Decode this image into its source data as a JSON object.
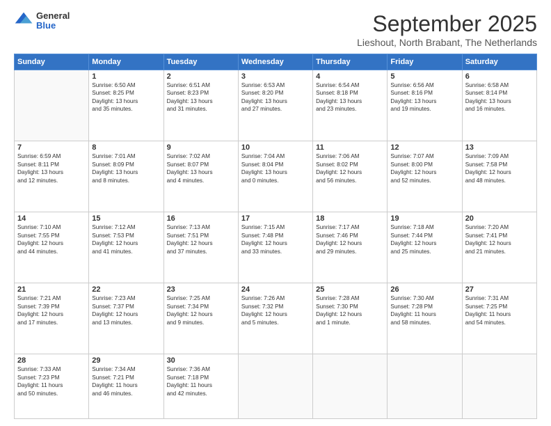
{
  "header": {
    "logo": {
      "general": "General",
      "blue": "Blue"
    },
    "title": "September 2025",
    "location": "Lieshout, North Brabant, The Netherlands"
  },
  "weekdays": [
    "Sunday",
    "Monday",
    "Tuesday",
    "Wednesday",
    "Thursday",
    "Friday",
    "Saturday"
  ],
  "weeks": [
    [
      {
        "day": "",
        "info": ""
      },
      {
        "day": "1",
        "info": "Sunrise: 6:50 AM\nSunset: 8:25 PM\nDaylight: 13 hours\nand 35 minutes."
      },
      {
        "day": "2",
        "info": "Sunrise: 6:51 AM\nSunset: 8:23 PM\nDaylight: 13 hours\nand 31 minutes."
      },
      {
        "day": "3",
        "info": "Sunrise: 6:53 AM\nSunset: 8:20 PM\nDaylight: 13 hours\nand 27 minutes."
      },
      {
        "day": "4",
        "info": "Sunrise: 6:54 AM\nSunset: 8:18 PM\nDaylight: 13 hours\nand 23 minutes."
      },
      {
        "day": "5",
        "info": "Sunrise: 6:56 AM\nSunset: 8:16 PM\nDaylight: 13 hours\nand 19 minutes."
      },
      {
        "day": "6",
        "info": "Sunrise: 6:58 AM\nSunset: 8:14 PM\nDaylight: 13 hours\nand 16 minutes."
      }
    ],
    [
      {
        "day": "7",
        "info": "Sunrise: 6:59 AM\nSunset: 8:11 PM\nDaylight: 13 hours\nand 12 minutes."
      },
      {
        "day": "8",
        "info": "Sunrise: 7:01 AM\nSunset: 8:09 PM\nDaylight: 13 hours\nand 8 minutes."
      },
      {
        "day": "9",
        "info": "Sunrise: 7:02 AM\nSunset: 8:07 PM\nDaylight: 13 hours\nand 4 minutes."
      },
      {
        "day": "10",
        "info": "Sunrise: 7:04 AM\nSunset: 8:04 PM\nDaylight: 13 hours\nand 0 minutes."
      },
      {
        "day": "11",
        "info": "Sunrise: 7:06 AM\nSunset: 8:02 PM\nDaylight: 12 hours\nand 56 minutes."
      },
      {
        "day": "12",
        "info": "Sunrise: 7:07 AM\nSunset: 8:00 PM\nDaylight: 12 hours\nand 52 minutes."
      },
      {
        "day": "13",
        "info": "Sunrise: 7:09 AM\nSunset: 7:58 PM\nDaylight: 12 hours\nand 48 minutes."
      }
    ],
    [
      {
        "day": "14",
        "info": "Sunrise: 7:10 AM\nSunset: 7:55 PM\nDaylight: 12 hours\nand 44 minutes."
      },
      {
        "day": "15",
        "info": "Sunrise: 7:12 AM\nSunset: 7:53 PM\nDaylight: 12 hours\nand 41 minutes."
      },
      {
        "day": "16",
        "info": "Sunrise: 7:13 AM\nSunset: 7:51 PM\nDaylight: 12 hours\nand 37 minutes."
      },
      {
        "day": "17",
        "info": "Sunrise: 7:15 AM\nSunset: 7:48 PM\nDaylight: 12 hours\nand 33 minutes."
      },
      {
        "day": "18",
        "info": "Sunrise: 7:17 AM\nSunset: 7:46 PM\nDaylight: 12 hours\nand 29 minutes."
      },
      {
        "day": "19",
        "info": "Sunrise: 7:18 AM\nSunset: 7:44 PM\nDaylight: 12 hours\nand 25 minutes."
      },
      {
        "day": "20",
        "info": "Sunrise: 7:20 AM\nSunset: 7:41 PM\nDaylight: 12 hours\nand 21 minutes."
      }
    ],
    [
      {
        "day": "21",
        "info": "Sunrise: 7:21 AM\nSunset: 7:39 PM\nDaylight: 12 hours\nand 17 minutes."
      },
      {
        "day": "22",
        "info": "Sunrise: 7:23 AM\nSunset: 7:37 PM\nDaylight: 12 hours\nand 13 minutes."
      },
      {
        "day": "23",
        "info": "Sunrise: 7:25 AM\nSunset: 7:34 PM\nDaylight: 12 hours\nand 9 minutes."
      },
      {
        "day": "24",
        "info": "Sunrise: 7:26 AM\nSunset: 7:32 PM\nDaylight: 12 hours\nand 5 minutes."
      },
      {
        "day": "25",
        "info": "Sunrise: 7:28 AM\nSunset: 7:30 PM\nDaylight: 12 hours\nand 1 minute."
      },
      {
        "day": "26",
        "info": "Sunrise: 7:30 AM\nSunset: 7:28 PM\nDaylight: 11 hours\nand 58 minutes."
      },
      {
        "day": "27",
        "info": "Sunrise: 7:31 AM\nSunset: 7:25 PM\nDaylight: 11 hours\nand 54 minutes."
      }
    ],
    [
      {
        "day": "28",
        "info": "Sunrise: 7:33 AM\nSunset: 7:23 PM\nDaylight: 11 hours\nand 50 minutes."
      },
      {
        "day": "29",
        "info": "Sunrise: 7:34 AM\nSunset: 7:21 PM\nDaylight: 11 hours\nand 46 minutes."
      },
      {
        "day": "30",
        "info": "Sunrise: 7:36 AM\nSunset: 7:18 PM\nDaylight: 11 hours\nand 42 minutes."
      },
      {
        "day": "",
        "info": ""
      },
      {
        "day": "",
        "info": ""
      },
      {
        "day": "",
        "info": ""
      },
      {
        "day": "",
        "info": ""
      }
    ]
  ]
}
